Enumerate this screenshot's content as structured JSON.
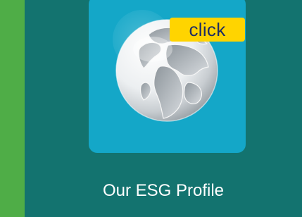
{
  "card": {
    "icon": "globe-icon",
    "badge": "click",
    "title": "Our ESG Profile"
  },
  "colors": {
    "sidebar_accent": "#4fad47",
    "panel_background": "#13736f",
    "tile_background": "#14a7c8",
    "badge_background": "#ffd400",
    "badge_text": "#1f2d63",
    "title_text": "#ffffff"
  }
}
